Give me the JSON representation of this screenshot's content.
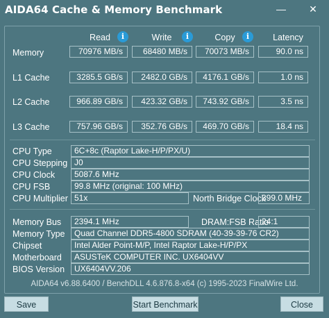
{
  "window": {
    "title": "AIDA64 Cache & Memory Benchmark",
    "minimize_glyph": "—",
    "close_glyph": "✕"
  },
  "columns": {
    "read": "Read",
    "write": "Write",
    "copy": "Copy",
    "latency": "Latency",
    "info_glyph": "i"
  },
  "rows": [
    {
      "label": "Memory",
      "read": "70976 MB/s",
      "write": "68480 MB/s",
      "copy": "70073 MB/s",
      "latency": "90.0 ns"
    },
    {
      "label": "L1 Cache",
      "read": "3285.5 GB/s",
      "write": "2482.0 GB/s",
      "copy": "4176.1 GB/s",
      "latency": "1.0 ns"
    },
    {
      "label": "L2 Cache",
      "read": "966.89 GB/s",
      "write": "423.32 GB/s",
      "copy": "743.92 GB/s",
      "latency": "3.5 ns"
    },
    {
      "label": "L3 Cache",
      "read": "757.96 GB/s",
      "write": "352.76 GB/s",
      "copy": "469.70 GB/s",
      "latency": "18.4 ns"
    }
  ],
  "cpu": {
    "type_label": "CPU Type",
    "type_value": "6C+8c   (Raptor Lake-H/P/PX/U)",
    "stepping_label": "CPU Stepping",
    "stepping_value": "J0",
    "clock_label": "CPU Clock",
    "clock_value": "5087.6 MHz",
    "fsb_label": "CPU FSB",
    "fsb_value": "99.8 MHz  (original: 100 MHz)",
    "multiplier_label": "CPU Multiplier",
    "multiplier_value": "51x",
    "nb_clock_label": "North Bridge Clock",
    "nb_clock_value": "399.0 MHz"
  },
  "system": {
    "memory_bus_label": "Memory Bus",
    "memory_bus_value": "2394.1 MHz",
    "dram_ratio_label": "DRAM:FSB Ratio",
    "dram_ratio_value": "24:1",
    "memory_type_label": "Memory Type",
    "memory_type_value": "Quad Channel DDR5-4800 SDRAM  (40-39-39-76 CR2)",
    "chipset_label": "Chipset",
    "chipset_value": "Intel Alder Point-M/P, Intel Raptor Lake-H/P/PX",
    "motherboard_label": "Motherboard",
    "motherboard_value": "ASUSTeK COMPUTER INC. UX6404VV",
    "bios_label": "BIOS Version",
    "bios_value": "UX6404VV.206"
  },
  "footer": "AIDA64 v6.88.6400 / BenchDLL 4.6.876.8-x64  (c) 1995-2023 FinalWire Ltd.",
  "buttons": {
    "save": "Save",
    "start": "Start Benchmark",
    "close": "Close"
  }
}
